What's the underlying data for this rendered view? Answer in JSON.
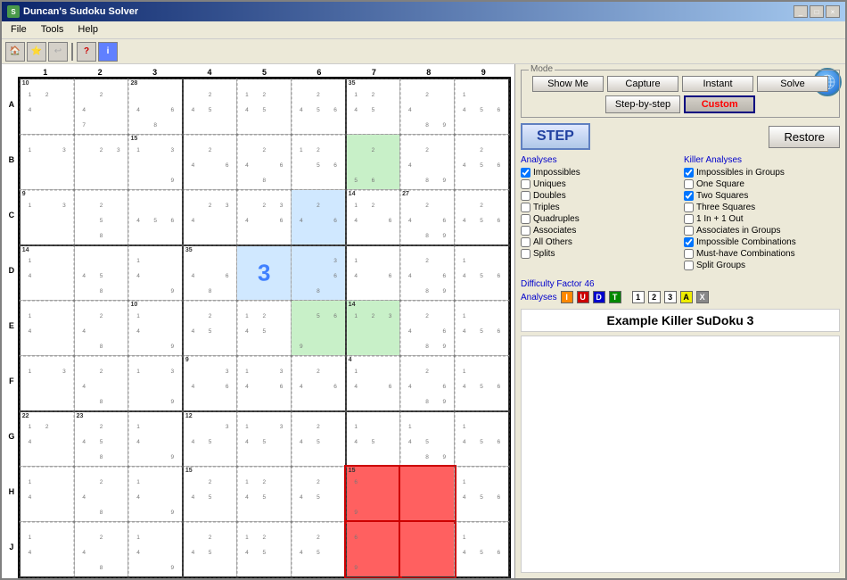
{
  "window": {
    "title": "Duncan's Sudoku Solver",
    "controls": [
      "_",
      "□",
      "×"
    ]
  },
  "menu": {
    "items": [
      "File",
      "Tools",
      "Help"
    ]
  },
  "toolbar": {
    "buttons": [
      "🏠",
      "⭐",
      "↩",
      "?",
      "i"
    ]
  },
  "mode": {
    "label": "Mode",
    "buttons": [
      "Show Me",
      "Capture",
      "Instant",
      "Solve",
      "Step-by-step",
      "Custom"
    ],
    "active": "Custom"
  },
  "main_buttons": {
    "step": "STEP",
    "restore": "Restore"
  },
  "analyses": {
    "title": "Analyses",
    "items": [
      {
        "label": "Impossibles",
        "checked": true
      },
      {
        "label": "Uniques",
        "checked": false
      },
      {
        "label": "Doubles",
        "checked": false
      },
      {
        "label": "Triples",
        "checked": false
      },
      {
        "label": "Quadruples",
        "checked": false
      },
      {
        "label": "Associates",
        "checked": false
      },
      {
        "label": "All Others",
        "checked": false
      },
      {
        "label": "Splits",
        "checked": false
      }
    ]
  },
  "killer_analyses": {
    "title": "Killer Analyses",
    "items": [
      {
        "label": "Impossibles in Groups",
        "checked": true
      },
      {
        "label": "One Square",
        "checked": false
      },
      {
        "label": "Two Squares",
        "checked": true
      },
      {
        "label": "Three Squares",
        "checked": false
      },
      {
        "label": "1 In + 1 Out",
        "checked": false
      },
      {
        "label": "Associates in Groups",
        "checked": false
      },
      {
        "label": "Impossible Combinations",
        "checked": true
      },
      {
        "label": "Must-have Combinations",
        "checked": false
      },
      {
        "label": "Split Groups",
        "checked": false
      }
    ]
  },
  "difficulty": {
    "label": "Difficulty Factor 46",
    "analyses_label": "Analyses",
    "tags": [
      "I",
      "U",
      "D",
      "T",
      "1",
      "2",
      "3",
      "A",
      "X"
    ]
  },
  "example_title": "Example Killer SuDoku 3",
  "col_labels": [
    "1",
    "2",
    "3",
    "4",
    "5",
    "6",
    "7",
    "8",
    "9"
  ],
  "row_labels": [
    "A",
    "B",
    "C",
    "D",
    "E",
    "F",
    "G",
    "H",
    "J"
  ]
}
